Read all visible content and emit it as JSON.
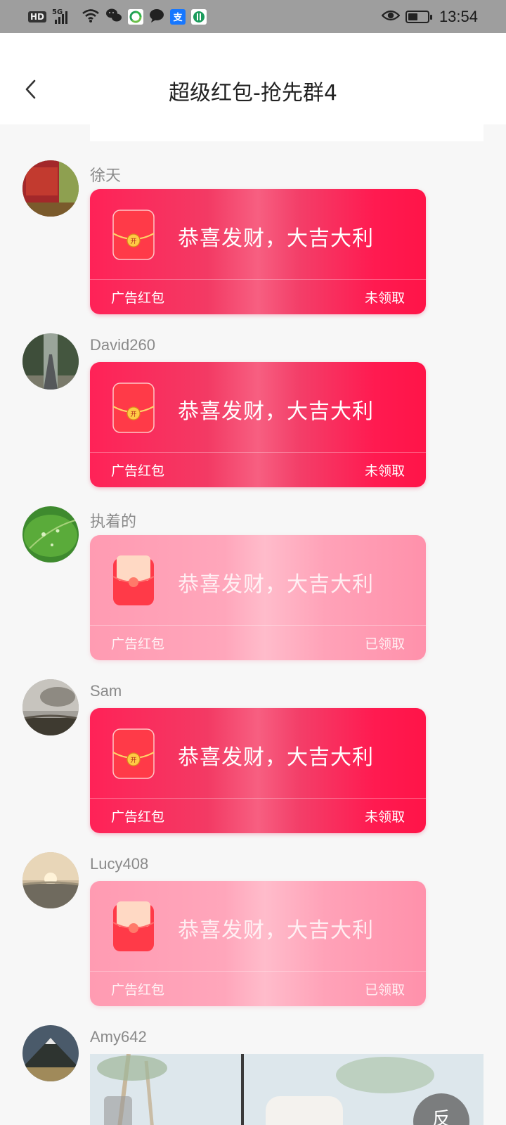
{
  "status_bar": {
    "time": "13:54",
    "network": "5G",
    "hd": "HD",
    "app_icons": [
      "recycle-app-icon",
      "chat-bubble-icon",
      "alipay-icon",
      "bank-app-icon"
    ]
  },
  "header": {
    "title": "超级红包-抢先群4"
  },
  "messages": [
    {
      "sender": "徐天",
      "greeting": "恭喜发财，大吉大利",
      "type": "广告红包",
      "status": "未领取",
      "claimed": false
    },
    {
      "sender": "David260",
      "greeting": "恭喜发财，大吉大利",
      "type": "广告红包",
      "status": "未领取",
      "claimed": false
    },
    {
      "sender": "执着的",
      "greeting": "恭喜发财，大吉大利",
      "type": "广告红包",
      "status": "已领取",
      "claimed": true
    },
    {
      "sender": "Sam",
      "greeting": "恭喜发财，大吉大利",
      "type": "广告红包",
      "status": "未领取",
      "claimed": false
    },
    {
      "sender": "Lucy408",
      "greeting": "恭喜发财，大吉大利",
      "type": "广告红包",
      "status": "已领取",
      "claimed": true
    },
    {
      "sender": "Amy642"
    }
  ],
  "feedback_button": {
    "label": "反"
  },
  "colors": {
    "unclaimed_packet": "#ff1f55",
    "claimed_packet": "#ffa3b9",
    "page_background": "#f7f7f7",
    "status_bar": "#9e9e9e"
  }
}
